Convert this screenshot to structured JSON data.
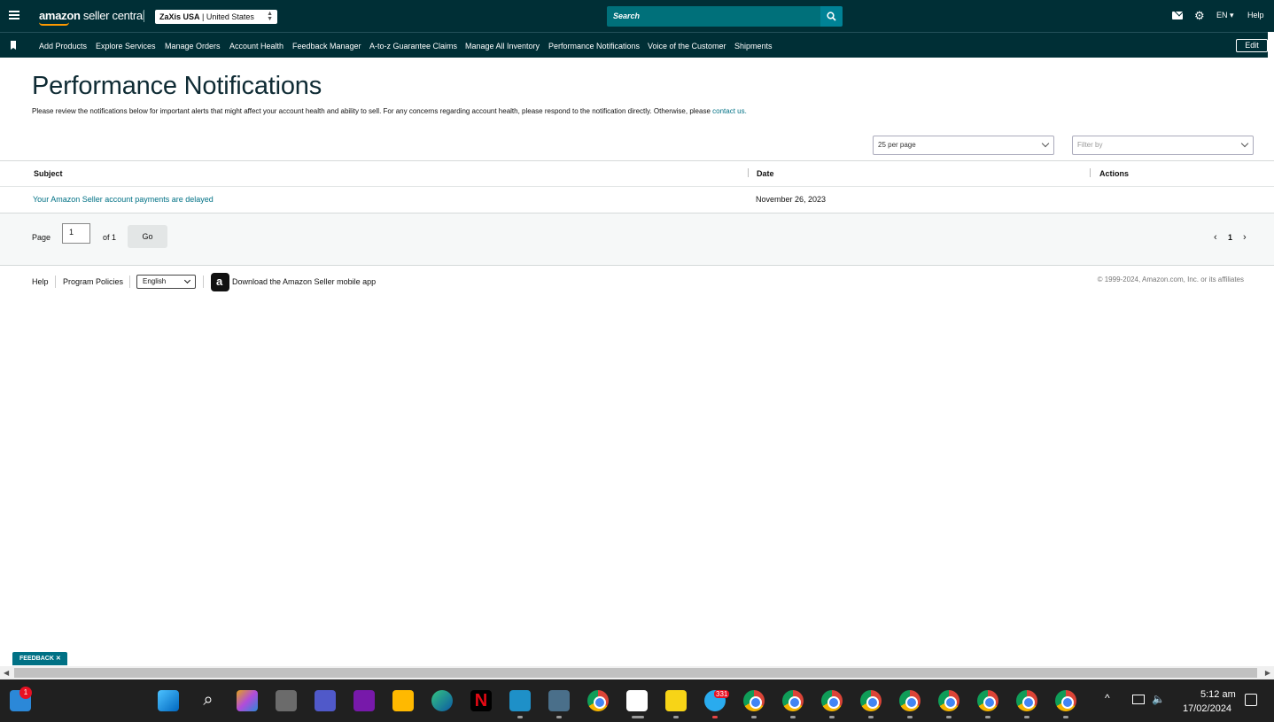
{
  "header": {
    "logo_main": "amazon",
    "logo_sub": " seller central",
    "account_store": "ZaXis USA",
    "account_region": "| United States",
    "search_placeholder": "Search",
    "language": "EN ▾",
    "help": "Help"
  },
  "nav": {
    "items": [
      "Add Products",
      "Explore Services",
      "Manage Orders",
      "Account Health",
      "Feedback Manager",
      "A-to-z Guarantee Claims",
      "Manage All Inventory",
      "Performance Notifications",
      "Voice of the Customer",
      "Shipments"
    ],
    "edit": "Edit"
  },
  "main": {
    "title": "Performance Notifications",
    "subtitle": "Please review the notifications below for important alerts that might affect your account health and ability to sell. For any concerns regarding account health, please respond to the notification directly. Otherwise, please",
    "subtitle_link": "contact us.",
    "per_page": "25 per page",
    "filter_placeholder": "Filter by",
    "columns": {
      "subject": "Subject",
      "date": "Date",
      "actions": "Actions"
    },
    "rows": [
      {
        "subject": "Your Amazon Seller account payments are delayed",
        "date": "November 26, 2023"
      }
    ]
  },
  "pagination": {
    "page_label": "Page",
    "current_page": "1",
    "of_label": "of 1",
    "go": "Go",
    "page_number": "1",
    "prev": "‹",
    "next": "›"
  },
  "footer": {
    "help": "Help",
    "policies": "Program Policies",
    "language": "English",
    "app_text": "Download the Amazon Seller mobile app",
    "copyright": "© 1999-2024, Amazon.com, Inc. or its affiliates"
  },
  "feedback": "FEEDBACK ✕",
  "taskbar": {
    "notification_count": "1",
    "telegram_badge": "331",
    "time": "5:12 am",
    "date": "17/02/2024"
  },
  "colors": {
    "header_bg": "#002f36",
    "search_bg": "#00707a",
    "link": "#007185"
  }
}
